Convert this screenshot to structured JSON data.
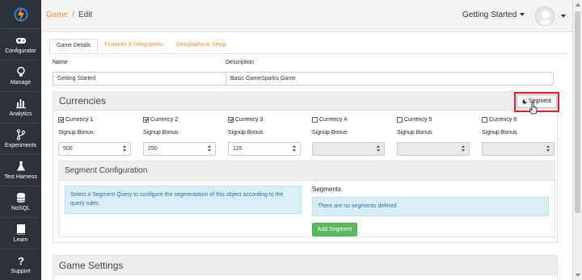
{
  "sidebar": {
    "items": [
      {
        "label": "Configurator",
        "icon": "gamepad-icon"
      },
      {
        "label": "Manage",
        "icon": "lightbulb-icon"
      },
      {
        "label": "Analytics",
        "icon": "bar-chart-icon"
      },
      {
        "label": "Experiments",
        "icon": "branch-icon"
      },
      {
        "label": "Test Harness",
        "icon": "flask-icon"
      },
      {
        "label": "NoSQL",
        "icon": "database-icon"
      },
      {
        "label": "Learn",
        "icon": "book-icon"
      },
      {
        "label": "Support",
        "icon": "question-icon"
      }
    ]
  },
  "topbar": {
    "breadcrumb_link": "Game",
    "breadcrumb_sep": "/",
    "breadcrumb_current": "Edit",
    "game_dropdown": "Getting Started"
  },
  "tabs": [
    "Game Details",
    "Features & Integrations",
    "Geographical Setup"
  ],
  "form": {
    "name_label": "Name",
    "name_value": "Getting Started",
    "description_label": "Description",
    "description_value": "Basic GameSparks Game"
  },
  "currencies": {
    "title": "Currencies",
    "segment_button": "Segment",
    "signup_label": "Signup Bonus",
    "items": [
      {
        "label": "Currency 1",
        "checked": true,
        "value": "500"
      },
      {
        "label": "Currency 2",
        "checked": true,
        "value": "250"
      },
      {
        "label": "Currency 3",
        "checked": true,
        "value": "125"
      },
      {
        "label": "Currency 4",
        "checked": false,
        "value": ""
      },
      {
        "label": "Currency 5",
        "checked": false,
        "value": ""
      },
      {
        "label": "Currency 6",
        "checked": false,
        "value": ""
      }
    ]
  },
  "segment_config": {
    "title": "Segment Configuration",
    "info": "Select a Segment Query to configure the segmentation of this object according to the query rules.",
    "segments_label": "Segments",
    "no_segments": "There are no segments defined.",
    "add_button": "Add Segment"
  },
  "game_settings": {
    "title": "Game Settings"
  },
  "colors": {
    "accent": "#f0932b",
    "sidebar": "#2e3238",
    "success": "#5cb85c",
    "highlight": "#d6282d"
  }
}
